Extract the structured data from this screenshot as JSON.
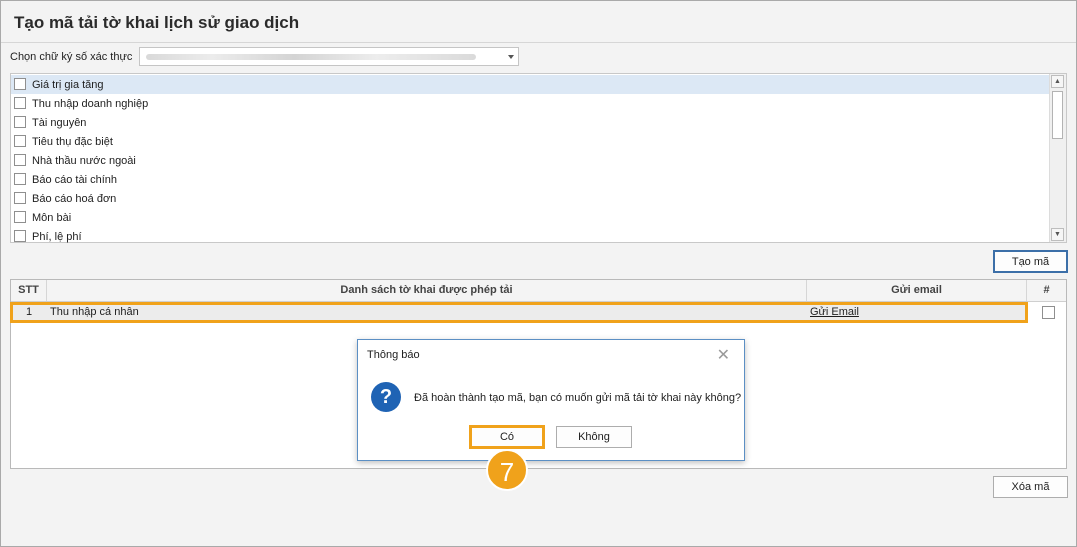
{
  "window": {
    "title": "Tạo mã tải tờ khai lịch sử giao dịch"
  },
  "signature": {
    "label": "Chọn chữ ký số xác thực",
    "value": ""
  },
  "declaration_types": [
    {
      "label": "Giá trị gia tăng",
      "selected": true
    },
    {
      "label": "Thu nhập doanh nghiệp"
    },
    {
      "label": "Tài nguyên"
    },
    {
      "label": "Tiêu thụ đặc biệt"
    },
    {
      "label": "Nhà thầu nước ngoài"
    },
    {
      "label": "Báo cáo tài chính"
    },
    {
      "label": "Báo cáo hoá đơn"
    },
    {
      "label": "Môn bài"
    },
    {
      "label": "Phí, lệ phí"
    }
  ],
  "buttons": {
    "create": "Tạo mã",
    "delete": "Xóa mã"
  },
  "grid": {
    "columns": [
      "STT",
      "Danh sách tờ khai được phép tải",
      "Gửi email",
      "#"
    ],
    "rows": [
      {
        "stt": "1",
        "name": "Thu nhập cá nhân",
        "email": "Gửi Email"
      }
    ]
  },
  "dialog": {
    "title": "Thông báo",
    "icon": "question-icon",
    "message": "Đã hoàn thành tạo mã, bạn có muốn gửi mã tải tờ khai này không?",
    "yes": "Có",
    "no": "Không"
  },
  "step_badge": "7",
  "colors": {
    "highlight": "#f0a21b",
    "accent": "#1f63b4",
    "selected_row": "#dce8f5"
  }
}
